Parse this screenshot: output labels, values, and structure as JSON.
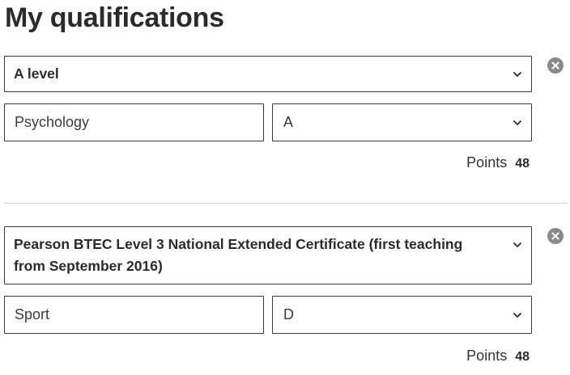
{
  "page": {
    "title": "My qualifications"
  },
  "qualifications": [
    {
      "type": "A level",
      "subject": "Psychology",
      "grade": "A",
      "points_label": "Points",
      "points": "48"
    },
    {
      "type": "Pearson BTEC Level 3 National Extended Certificate (first teaching from September 2016)",
      "subject": "Sport",
      "grade": "D",
      "points_label": "Points",
      "points": "48"
    }
  ],
  "icons": {
    "dropdown": "chevron-down-icon",
    "remove": "close-circle-icon"
  },
  "colors": {
    "text": "#2b2b2b",
    "border": "#3a3a3a",
    "remove_button": "#8a8a8a",
    "divider": "#d4d4d4"
  }
}
